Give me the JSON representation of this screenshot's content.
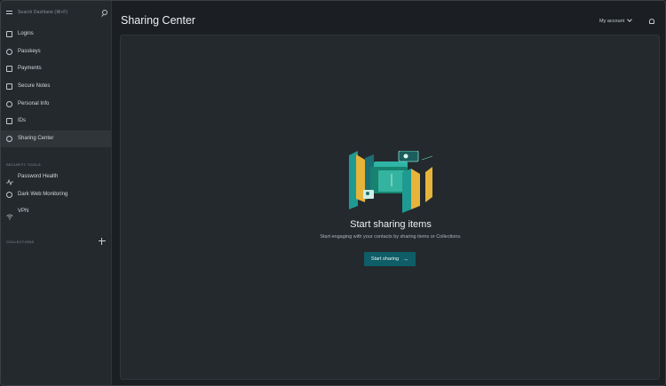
{
  "search": {
    "placeholder": "Search Dashlane (⌘+F)"
  },
  "sidebar": {
    "items": [
      {
        "label": "Logins",
        "icon": "home-icon"
      },
      {
        "label": "Passkeys",
        "icon": "passkey-icon"
      },
      {
        "label": "Payments",
        "icon": "card-icon"
      },
      {
        "label": "Secure Notes",
        "icon": "note-icon"
      },
      {
        "label": "Personal Info",
        "icon": "person-icon"
      },
      {
        "label": "IDs",
        "icon": "id-card-icon"
      },
      {
        "label": "Sharing Center",
        "icon": "sharing-icon"
      }
    ],
    "security_label": "SECURITY TOOLS",
    "security_items": [
      {
        "label": "Password Health",
        "icon": "pulse-icon"
      },
      {
        "label": "Dark Web Monitoring",
        "icon": "web-icon"
      },
      {
        "label": "VPN",
        "icon": "wifi-icon"
      }
    ],
    "collections_label": "COLLECTIONS"
  },
  "header": {
    "title": "Sharing Center",
    "account_label": "My account"
  },
  "main": {
    "empty_title": "Start sharing items",
    "empty_subtitle": "Start engaging with your contacts by sharing items or Collections.",
    "cta_label": "Start sharing",
    "cta_arrow": "→"
  },
  "colors": {
    "background": "#1b1f23",
    "sidebar": "#24292e",
    "accent": "#0f5d66",
    "illustration_teal": "#1f9a92",
    "illustration_yellow": "#e6b43a"
  }
}
